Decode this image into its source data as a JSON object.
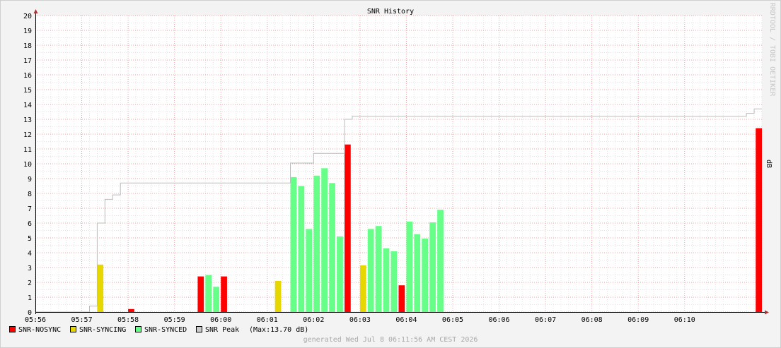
{
  "chart_data": {
    "type": "bar",
    "title": "SNR History",
    "ylabel": "dB",
    "ylim": [
      0,
      20
    ],
    "y_ticks": [
      0,
      1,
      2,
      3,
      4,
      5,
      6,
      7,
      8,
      9,
      10,
      11,
      12,
      13,
      14,
      15,
      16,
      17,
      18,
      19,
      20
    ],
    "x_ticks": [
      "05:56",
      "05:57",
      "05:58",
      "05:59",
      "06:00",
      "06:01",
      "06:02",
      "06:03",
      "06:04",
      "06:05",
      "06:06",
      "06:07",
      "06:08",
      "06:09",
      "06:10"
    ],
    "x_range_seconds": [
      0,
      940
    ],
    "grid": true,
    "series": [
      {
        "name": "SNR-NOSYNC",
        "color": "#ff0000",
        "points": [
          {
            "t": 120,
            "w": 8,
            "v": 0.2
          },
          {
            "t": 210,
            "w": 8,
            "v": 2.4
          },
          {
            "t": 240,
            "w": 8,
            "v": 2.4
          },
          {
            "t": 400,
            "w": 8,
            "v": 11.3
          },
          {
            "t": 470,
            "w": 8,
            "v": 1.8
          },
          {
            "t": 932,
            "w": 8,
            "v": 12.4
          }
        ]
      },
      {
        "name": "SNR-SYNCING",
        "color": "#e6d700",
        "points": [
          {
            "t": 80,
            "w": 8,
            "v": 3.2
          },
          {
            "t": 310,
            "w": 8,
            "v": 2.1
          },
          {
            "t": 420,
            "w": 8,
            "v": 3.15
          }
        ]
      },
      {
        "name": "SNR-SYNCED",
        "color": "#66ff88",
        "points": [
          {
            "t": 220,
            "w": 8,
            "v": 2.5
          },
          {
            "t": 230,
            "w": 8,
            "v": 1.7
          },
          {
            "t": 330,
            "w": 8,
            "v": 9.1
          },
          {
            "t": 340,
            "w": 8,
            "v": 8.5
          },
          {
            "t": 350,
            "w": 8,
            "v": 5.6
          },
          {
            "t": 360,
            "w": 8,
            "v": 9.2
          },
          {
            "t": 370,
            "w": 8,
            "v": 9.7
          },
          {
            "t": 380,
            "w": 8,
            "v": 8.7
          },
          {
            "t": 390,
            "w": 8,
            "v": 5.1
          },
          {
            "t": 430,
            "w": 8,
            "v": 5.6
          },
          {
            "t": 440,
            "w": 8,
            "v": 5.8
          },
          {
            "t": 450,
            "w": 8,
            "v": 4.3
          },
          {
            "t": 460,
            "w": 8,
            "v": 4.1
          },
          {
            "t": 480,
            "w": 8,
            "v": 6.1
          },
          {
            "t": 490,
            "w": 8,
            "v": 5.25
          },
          {
            "t": 500,
            "w": 8,
            "v": 4.95
          },
          {
            "t": 510,
            "w": 8,
            "v": 6.05
          },
          {
            "t": 520,
            "w": 8,
            "v": 6.9
          }
        ]
      },
      {
        "name": "SNR Peak",
        "color": "#bbbbbb",
        "type": "step",
        "points": [
          {
            "t": 0,
            "v": 0
          },
          {
            "t": 70,
            "v": 0.4
          },
          {
            "t": 80,
            "v": 6.0
          },
          {
            "t": 90,
            "v": 7.6
          },
          {
            "t": 100,
            "v": 7.9
          },
          {
            "t": 110,
            "v": 8.7
          },
          {
            "t": 330,
            "v": 10.05
          },
          {
            "t": 360,
            "v": 10.7
          },
          {
            "t": 400,
            "v": 13.0
          },
          {
            "t": 410,
            "v": 13.2
          },
          {
            "t": 920,
            "v": 13.4
          },
          {
            "t": 930,
            "v": 13.7
          },
          {
            "t": 940,
            "v": 13.7
          }
        ]
      }
    ],
    "legend": [
      {
        "name": "SNR-NOSYNC",
        "color": "#ff0000"
      },
      {
        "name": "SNR-SYNCING",
        "color": "#e6d700"
      },
      {
        "name": "SNR-SYNCED",
        "color": "#66ff88"
      },
      {
        "name": "SNR Peak",
        "color": "#cccccc"
      }
    ],
    "legend_note": "(Max:13.70 dB)",
    "legend_placement": "bottom-left",
    "credit": "RRDTOOL / TOBI OETIKER",
    "footer": "generated Wed Jul  8 06:11:56 AM CEST 2026"
  }
}
